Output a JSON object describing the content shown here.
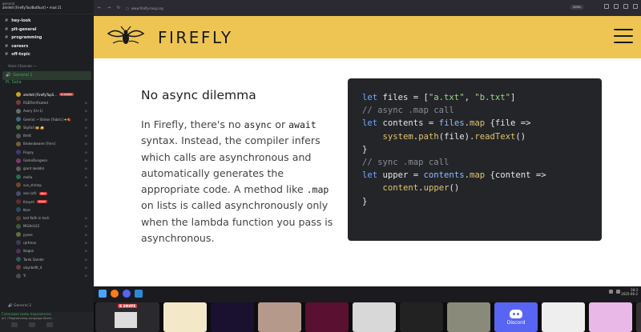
{
  "browser": {
    "url": "www.firefly-lang.org",
    "zoom": "200%"
  },
  "site": {
    "name": "FIREFLY"
  },
  "article": {
    "heading": "No async dilemma",
    "para": {
      "t1": "In Firefly, there's no ",
      "c1": "async",
      "t2": " or ",
      "c2": "await",
      "t3": " syntax. Instead, the compiler infers which calls are asynchronous and automatically generates the appropriate code. A method like ",
      "c3": ".map",
      "t4": " on lists is called asynchronously only when the lambda function you pass is asynchronous."
    }
  },
  "code": {
    "l1": {
      "kw": "let",
      "rest": " files = [",
      "s1": "\"a.txt\"",
      "comma": ", ",
      "s2": "\"b.txt\"",
      "end": "]"
    },
    "l2": "// async .map call",
    "l3": {
      "kw": "let",
      "rest": " contents = ",
      "obj": "files",
      "dot": ".",
      "fn": "map",
      "end": " {file =>"
    },
    "l4": {
      "indent": "    ",
      "obj": "system",
      "dot": ".",
      "fn": "path",
      "arg": "(file).",
      "fn2": "readText",
      "end": "()"
    },
    "l5": "}",
    "l6": "// sync .map call",
    "l7": {
      "kw": "let",
      "rest": " upper = ",
      "obj": "contents",
      "dot": ".",
      "fn": "map",
      "end": " {content =>"
    },
    "l8": {
      "indent": "    ",
      "obj": "content",
      "dot": ".",
      "fn": "upper",
      "end": "()"
    },
    "l9": "}"
  },
  "discord": {
    "header_line1": "general",
    "header_line2": "ahnfelt [FireflyToolBotRust] • mod 21",
    "channels": [
      {
        "name": "hey-look"
      },
      {
        "name": "plt-general"
      },
      {
        "name": "programming"
      },
      {
        "name": "careers"
      },
      {
        "name": "off-topic"
      }
    ],
    "voice_header": "Voice Channels —",
    "voice_channel": "General 1",
    "voice_sub": "Pi: Salia",
    "users": [
      {
        "name": "ahnfelt [FireflyTopS...",
        "badge": "В ЭФИРЕ"
      },
      {
        "name": "RGBTerrificated",
        "badge": ""
      },
      {
        "name": "Avery (U+1)",
        "badge": ""
      },
      {
        "name": "Gemini: • Striker [Fabric] ✚🍓",
        "badge": ""
      },
      {
        "name": "SkyFall 🐸 🍰",
        "badge": ""
      },
      {
        "name": "Brett",
        "badge": ""
      },
      {
        "name": "Brokenbearer [Fern]",
        "badge": ""
      },
      {
        "name": "Flopsy",
        "badge": ""
      },
      {
        "name": "GameDungeon",
        "badge": ""
      },
      {
        "name": "giant (waldo)",
        "badge": ""
      },
      {
        "name": "molla",
        "badge": ""
      },
      {
        "name": "sun_shrimp",
        "badge": ""
      },
      {
        "name": "soo (utl)",
        "badge": "PRO"
      },
      {
        "name": "Kroyeh",
        "badge": "ЭФИР"
      },
      {
        "name": "Kore",
        "badge": ""
      },
      {
        "name": "lost faith in tech",
        "badge": ""
      },
      {
        "name": "MGlitch22",
        "badge": ""
      },
      {
        "name": "pyxes",
        "badge": ""
      },
      {
        "name": "rprtman",
        "badge": ""
      },
      {
        "name": "lkegan",
        "badge": ""
      },
      {
        "name": "Tarek Sander",
        "badge": ""
      },
      {
        "name": "vikyrbefit_4",
        "badge": ""
      },
      {
        "name": "Yi",
        "badge": ""
      }
    ],
    "voice_channel2": "General 2",
    "status": "Голосовая связь подключена",
    "status_sub": "al1 / Programming Language Devel..."
  },
  "taskbar": {
    "time": "18:3",
    "date": "2025-06-2"
  },
  "streams": {
    "live_label": "В ЭФИРЕ",
    "discord_label": "Discord"
  },
  "colors": {
    "firefly_yellow": "#eec553",
    "code_bg": "#232529",
    "discord_blurple": "#5865f2"
  }
}
